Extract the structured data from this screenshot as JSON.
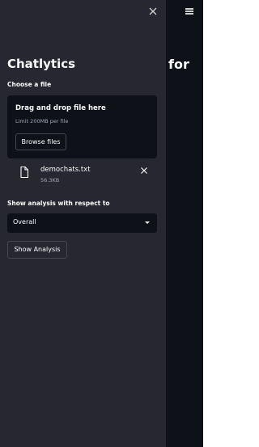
{
  "sidebar": {
    "title": "Chatlytics",
    "close_icon": "close-icon",
    "uploader": {
      "label": "Choose a file",
      "dropzone_title": "Drag and drop file here",
      "dropzone_limit": "Limit 200MB per file",
      "browse_label": "Browse files"
    },
    "uploaded_file": {
      "icon": "file-icon",
      "name": "demochats.txt",
      "size": "56.3KB",
      "remove_icon": "close-icon"
    },
    "analysis_select": {
      "label": "Show analysis with respect to",
      "value": "Overall"
    },
    "show_button_label": "Show Analysis"
  },
  "main": {
    "menu_icon": "hamburger-menu-icon",
    "title_fragment": "for"
  },
  "colors": {
    "sidebar_bg": "#262730",
    "main_bg": "#0e1117",
    "text": "#fafafa",
    "muted_text": "#a3a8b8"
  }
}
